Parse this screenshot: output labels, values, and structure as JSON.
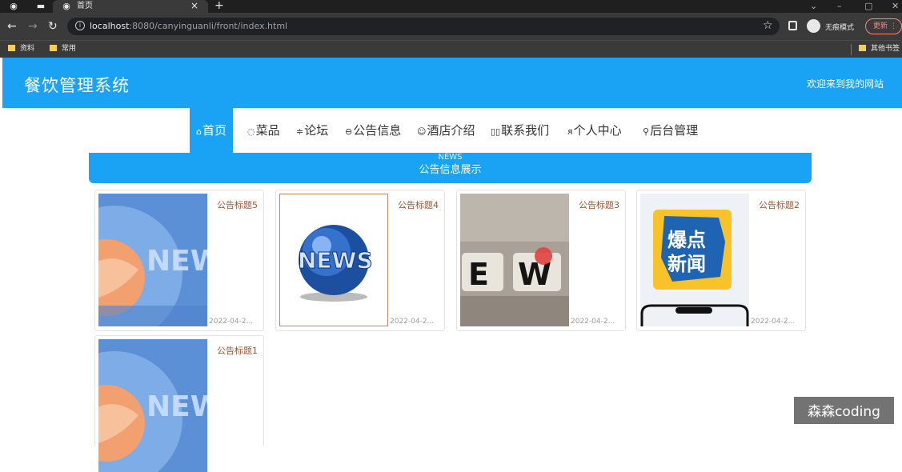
{
  "browser": {
    "tab_title": "首页",
    "tab_close": "×",
    "new_tab": "+",
    "url_host": "localhost",
    "url_path": ":8080/canyinguanli/front/index.html",
    "incognito_label": "无痕模式",
    "update_label": "更新",
    "bookmarks": [
      "资料",
      "常用"
    ],
    "other_bookmarks": "其他书签"
  },
  "header": {
    "site_title": "餐饮管理系统",
    "welcome": "欢迎来到我的网站"
  },
  "nav": {
    "items": [
      {
        "icon": "⌂",
        "label": "首页",
        "active": true
      },
      {
        "icon": "◌",
        "label": "菜品"
      },
      {
        "icon": "≑",
        "label": "论坛"
      },
      {
        "icon": "⊖",
        "label": "公告信息"
      },
      {
        "icon": "☺",
        "label": "酒店介绍"
      },
      {
        "icon": "▯▯",
        "label": "联系我们"
      },
      {
        "icon": "ᴙ",
        "label": "个人中心"
      },
      {
        "icon": "⚲",
        "label": "后台管理"
      }
    ]
  },
  "section": {
    "en_title": "NEWS",
    "cn_title": "公告信息展示"
  },
  "cards": [
    {
      "title": "公告标题5",
      "date": "2022-04-2...",
      "image": "news-globe-blue"
    },
    {
      "title": "公告标题4",
      "date": "2022-04-2...",
      "image": "news-globe-3d"
    },
    {
      "title": "公告标题3",
      "date": "2022-04-2...",
      "image": "news-dice"
    },
    {
      "title": "公告标题2",
      "date": "2022-04-2...",
      "image": "breaking-news-phone"
    },
    {
      "title": "公告标题1",
      "date": "",
      "image": "news-globe-blue"
    }
  ],
  "images": {
    "news_word": "NEWS",
    "dice_letters": [
      "E",
      "W"
    ],
    "breaking_line1": "爆点",
    "breaking_line2": "新闻"
  },
  "watermark": "森森coding",
  "colors": {
    "accent": "#1aa3f4",
    "card_title": "#a0522d"
  }
}
